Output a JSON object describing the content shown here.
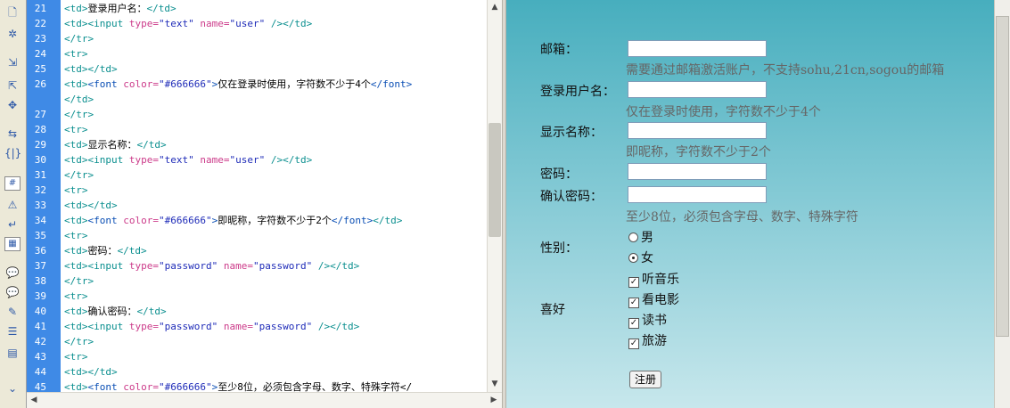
{
  "toolbar": {
    "icons": [
      "page-icon",
      "gear-icon",
      "expand-icon",
      "collapse-icon",
      "select-icon",
      "tag-icon",
      "braces-icon",
      "line-numbers-icon",
      "warning-icon",
      "wrap-icon",
      "highlight-icon",
      "comment-icon",
      "uncomment-icon",
      "edit-icon",
      "indent-icon",
      "format-icon",
      "more-icon"
    ],
    "glyphs": [
      "🗋",
      "✲",
      "⇲",
      "⇱",
      "✥",
      "⇆",
      "{|}",
      "#",
      "⚠",
      "↵",
      "▦",
      "💬",
      "💬",
      "✎",
      "☰",
      "▤",
      "⌄"
    ]
  },
  "editor": {
    "lines": [
      {
        "num": "21",
        "segs": [
          [
            "tag",
            "<td>"
          ],
          [
            "text",
            "登录用户名："
          ],
          [
            "tag",
            "</td>"
          ]
        ]
      },
      {
        "num": "22",
        "segs": [
          [
            "tag",
            "<td><input "
          ],
          [
            "attr",
            "type="
          ],
          [
            "val",
            "\"text\" "
          ],
          [
            "attr",
            "name="
          ],
          [
            "val",
            "\"user\" "
          ],
          [
            "tag",
            "/></td>"
          ]
        ]
      },
      {
        "num": "23",
        "segs": [
          [
            "tag",
            "</tr>"
          ]
        ]
      },
      {
        "num": "24",
        "segs": [
          [
            "tag",
            "<tr>"
          ]
        ]
      },
      {
        "num": "25",
        "segs": [
          [
            "tag",
            "<td></td>"
          ]
        ]
      },
      {
        "num": "26",
        "segs": [
          [
            "tag",
            "<td>"
          ],
          [
            "ftag",
            "<font "
          ],
          [
            "attr",
            "color="
          ],
          [
            "val",
            "\"#666666\""
          ],
          [
            "ftag",
            ">"
          ],
          [
            "text",
            "仅在登录时使用，字符数不少于4个"
          ],
          [
            "ftag",
            "</font>"
          ]
        ]
      },
      {
        "num": "",
        "segs": [
          [
            "tag",
            "</td>"
          ]
        ]
      },
      {
        "num": "27",
        "segs": [
          [
            "tag",
            "</tr>"
          ]
        ]
      },
      {
        "num": "28",
        "segs": [
          [
            "tag",
            "<tr>"
          ]
        ]
      },
      {
        "num": "29",
        "segs": [
          [
            "tag",
            "<td>"
          ],
          [
            "text",
            "显示名称："
          ],
          [
            "tag",
            "</td>"
          ]
        ]
      },
      {
        "num": "30",
        "segs": [
          [
            "tag",
            "<td><input "
          ],
          [
            "attr",
            "type="
          ],
          [
            "val",
            "\"text\" "
          ],
          [
            "attr",
            "name="
          ],
          [
            "val",
            "\"user\" "
          ],
          [
            "tag",
            "/></td>"
          ]
        ]
      },
      {
        "num": "31",
        "segs": [
          [
            "tag",
            "</tr>"
          ]
        ]
      },
      {
        "num": "32",
        "segs": [
          [
            "tag",
            "<tr>"
          ]
        ]
      },
      {
        "num": "33",
        "segs": [
          [
            "tag",
            "<td></td>"
          ]
        ]
      },
      {
        "num": "34",
        "segs": [
          [
            "tag",
            "<td>"
          ],
          [
            "ftag",
            "<font "
          ],
          [
            "attr",
            "color="
          ],
          [
            "val",
            "\"#666666\""
          ],
          [
            "ftag",
            ">"
          ],
          [
            "text",
            "即昵称，字符数不少于2个"
          ],
          [
            "ftag",
            "</font>"
          ],
          [
            "tag",
            "</td>"
          ]
        ]
      },
      {
        "num": "35",
        "segs": [
          [
            "tag",
            "<tr>"
          ]
        ]
      },
      {
        "num": "36",
        "segs": [
          [
            "tag",
            "<td>"
          ],
          [
            "text",
            "密码："
          ],
          [
            "tag",
            "</td>"
          ]
        ]
      },
      {
        "num": "37",
        "segs": [
          [
            "tag",
            "<td><input "
          ],
          [
            "attr",
            "type="
          ],
          [
            "val",
            "\"password\" "
          ],
          [
            "attr",
            "name="
          ],
          [
            "val",
            "\"password\" "
          ],
          [
            "tag",
            "/></td>"
          ]
        ]
      },
      {
        "num": "38",
        "segs": [
          [
            "tag",
            "</tr>"
          ]
        ]
      },
      {
        "num": "39",
        "segs": [
          [
            "tag",
            "<tr>"
          ]
        ]
      },
      {
        "num": "40",
        "segs": [
          [
            "tag",
            "<td>"
          ],
          [
            "text",
            "确认密码："
          ],
          [
            "tag",
            "</td>"
          ]
        ]
      },
      {
        "num": "41",
        "segs": [
          [
            "tag",
            "<td><input "
          ],
          [
            "attr",
            "type="
          ],
          [
            "val",
            "\"password\" "
          ],
          [
            "attr",
            "name="
          ],
          [
            "val",
            "\"password\" "
          ],
          [
            "tag",
            "/></td>"
          ]
        ]
      },
      {
        "num": "42",
        "segs": [
          [
            "tag",
            "</tr>"
          ]
        ]
      },
      {
        "num": "43",
        "segs": [
          [
            "tag",
            "<tr>"
          ]
        ]
      },
      {
        "num": "44",
        "segs": [
          [
            "tag",
            "<td></td>"
          ]
        ]
      },
      {
        "num": "45",
        "segs": [
          [
            "tag",
            "<td>"
          ],
          [
            "ftag",
            "<font "
          ],
          [
            "attr",
            "color="
          ],
          [
            "val",
            "\"#666666\""
          ],
          [
            "ftag",
            ">"
          ],
          [
            "text",
            "至少8位，必须包含字母、数字、特殊字符</"
          ]
        ]
      }
    ]
  },
  "form": {
    "email_label": "邮箱：",
    "email_hint": "需要通过邮箱激活账户，不支持sohu,21cn,sogou的邮箱",
    "username_label": "登录用户名：",
    "username_hint": "仅在登录时使用，字符数不少于4个",
    "display_label": "显示名称：",
    "display_hint": "即昵称，字符数不少于2个",
    "password_label": "密码：",
    "confirm_label": "确认密码：",
    "password_hint": "至少8位，必须包含字母、数字、特殊字符",
    "gender_label": "性别：",
    "gender_options": [
      {
        "label": "男",
        "checked": false
      },
      {
        "label": "女",
        "checked": true
      }
    ],
    "hobby_label": "喜好",
    "hobby_options": [
      {
        "label": "听音乐",
        "checked": true
      },
      {
        "label": "看电影",
        "checked": true
      },
      {
        "label": "读书",
        "checked": true
      },
      {
        "label": "旅游",
        "checked": true
      }
    ],
    "submit_label": "注册"
  }
}
